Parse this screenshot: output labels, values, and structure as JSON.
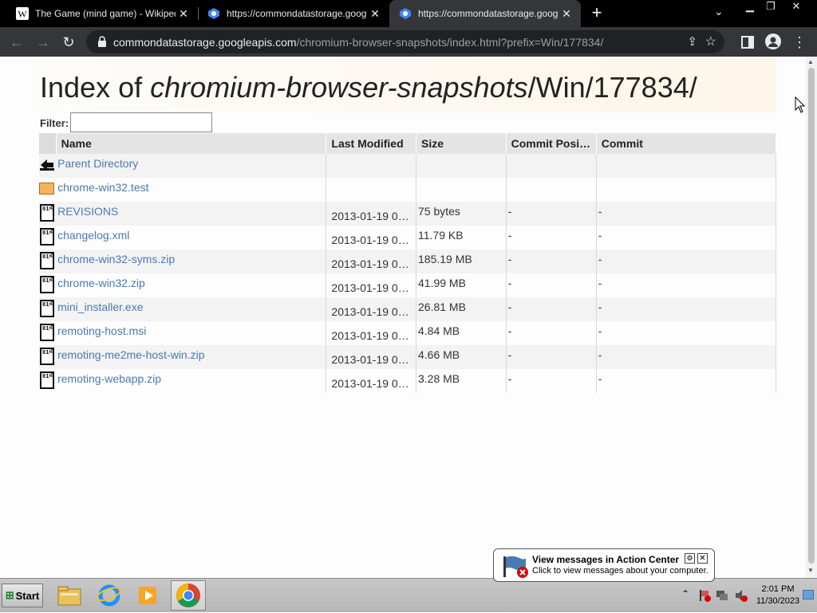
{
  "browser": {
    "tabs": [
      {
        "title": "The Game (mind game) - Wikipedia",
        "favicon": "wikipedia-icon",
        "active": false
      },
      {
        "title": "https://commondatastorage.googleap",
        "favicon": "google-cloud-icon",
        "active": false
      },
      {
        "title": "https://commondatastorage.googleap",
        "favicon": "google-cloud-icon",
        "active": true
      }
    ],
    "url_host": "commondatastorage.googleapis.com",
    "url_path": "/chromium-browser-snapshots/index.html?prefix=Win/177834/"
  },
  "page": {
    "title_prefix": "Index of ",
    "title_italic": "chromium-browser-snapshots",
    "title_suffix": "/Win/177834/",
    "filter_label": "Filter:",
    "filter_value": "",
    "columns": [
      "Name",
      "Last Modified",
      "Size",
      "Commit Posi…",
      "Commit"
    ],
    "rows": [
      {
        "icon": "parent-directory-icon",
        "name": "Parent Directory",
        "modified": "",
        "size": "",
        "commit_pos": "",
        "commit": ""
      },
      {
        "icon": "folder-icon",
        "name": "chrome-win32.test",
        "modified": "",
        "size": "",
        "commit_pos": "",
        "commit": ""
      },
      {
        "icon": "binary-file-icon",
        "name": "REVISIONS",
        "modified": "2013-01-19 0…",
        "size": "75 bytes",
        "commit_pos": "-",
        "commit": "-"
      },
      {
        "icon": "binary-file-icon",
        "name": "changelog.xml",
        "modified": "2013-01-19 0…",
        "size": "11.79 KB",
        "commit_pos": "-",
        "commit": "-"
      },
      {
        "icon": "binary-file-icon",
        "name": "chrome-win32-syms.zip",
        "modified": "2013-01-19 0…",
        "size": "185.19 MB",
        "commit_pos": "-",
        "commit": "-"
      },
      {
        "icon": "binary-file-icon",
        "name": "chrome-win32.zip",
        "modified": "2013-01-19 0…",
        "size": "41.99 MB",
        "commit_pos": "-",
        "commit": "-"
      },
      {
        "icon": "binary-file-icon",
        "name": "mini_installer.exe",
        "modified": "2013-01-19 0…",
        "size": "26.81 MB",
        "commit_pos": "-",
        "commit": "-"
      },
      {
        "icon": "binary-file-icon",
        "name": "remoting-host.msi",
        "modified": "2013-01-19 0…",
        "size": "4.84 MB",
        "commit_pos": "-",
        "commit": "-"
      },
      {
        "icon": "binary-file-icon",
        "name": "remoting-me2me-host-win.zip",
        "modified": "2013-01-19 0…",
        "size": "4.66 MB",
        "commit_pos": "-",
        "commit": "-"
      },
      {
        "icon": "binary-file-icon",
        "name": "remoting-webapp.zip",
        "modified": "2013-01-19 0…",
        "size": "3.28 MB",
        "commit_pos": "-",
        "commit": "-"
      }
    ]
  },
  "taskbar": {
    "start_label": "Start",
    "apps": [
      "explorer-icon",
      "internet-explorer-icon",
      "media-player-icon",
      "chrome-icon"
    ],
    "time": "2:01 PM",
    "date": "11/30/2023"
  },
  "balloon": {
    "title": "View messages in Action Center",
    "text": "Click to view messages about your computer."
  },
  "colors": {
    "tab_bar": "#000000",
    "toolbar": "#35363a",
    "link": "#4a7ab3",
    "row_alt": "#f3f3f3"
  }
}
